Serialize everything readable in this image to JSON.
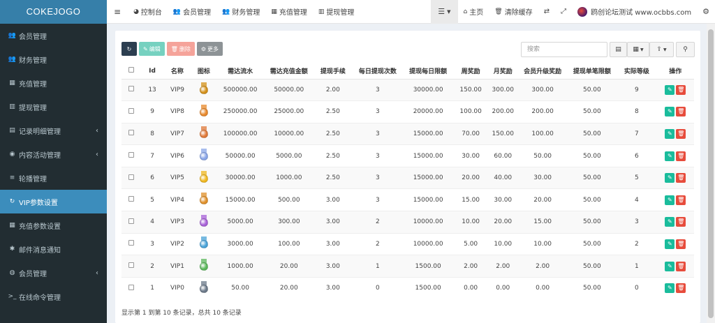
{
  "brand": "COKEJOGO",
  "sidebar": {
    "items": [
      {
        "label": "会员管理",
        "icon": "users-icon",
        "glyph": "👥",
        "arrow": ""
      },
      {
        "label": "财务管理",
        "icon": "users-icon",
        "glyph": "👥",
        "arrow": ""
      },
      {
        "label": "充值管理",
        "icon": "grid-icon",
        "glyph": "▦",
        "arrow": ""
      },
      {
        "label": "提现管理",
        "icon": "bank-icon",
        "glyph": "▥",
        "arrow": ""
      },
      {
        "label": "记录明细管理",
        "icon": "bar-chart-icon",
        "glyph": "▤",
        "arrow": "‹"
      },
      {
        "label": "内容活动管理",
        "icon": "globe-icon",
        "glyph": "◉",
        "arrow": "‹"
      },
      {
        "label": "轮播管理",
        "icon": "list-icon",
        "glyph": "≡",
        "arrow": ""
      },
      {
        "label": "VIP参数设置",
        "icon": "refresh-icon",
        "glyph": "↻",
        "arrow": ""
      },
      {
        "label": "充值参数设置",
        "icon": "grid-icon",
        "glyph": "▦",
        "arrow": ""
      },
      {
        "label": "邮件消息通知",
        "icon": "asterisk-icon",
        "glyph": "✱",
        "arrow": ""
      },
      {
        "label": "会员管理",
        "icon": "user-circle-icon",
        "glyph": "◍",
        "arrow": "‹"
      },
      {
        "label": "在线命令管理",
        "icon": "terminal-icon",
        "glyph": ">_",
        "arrow": ""
      }
    ],
    "active_index": 7
  },
  "topbar": {
    "menu_toggle": "≡",
    "dashboard": "控制台",
    "members": "会员管理",
    "finance": "财务管理",
    "recharge": "充值管理",
    "withdraw": "提现管理",
    "home": "主页",
    "clear_cache": "清除缓存",
    "site_name": "鸥创论坛测试 www.ocbbs.com"
  },
  "toolbar": {
    "edit": "编辑",
    "delete": "删除",
    "more": "更多",
    "search_placeholder": "搜索"
  },
  "table": {
    "headers": [
      "Id",
      "名称",
      "图标",
      "需达流水",
      "需达充值金额",
      "提现手续",
      "每日提现次数",
      "提现每日限额",
      "周奖励",
      "月奖励",
      "会员升级奖励",
      "提现单笔限额",
      "实际等级",
      "操作"
    ],
    "rows": [
      {
        "id": "13",
        "name": "VIP9",
        "medal": "#d4911a",
        "turnover": "500000.00",
        "recharge": "50000.00",
        "fee": "2.00",
        "daily_times": "3",
        "daily_limit": "30000.00",
        "weekly": "150.00",
        "monthly": "300.00",
        "upgrade": "300.00",
        "single_limit": "50.00",
        "level": "9"
      },
      {
        "id": "9",
        "name": "VIP8",
        "medal": "#e8892c",
        "turnover": "250000.00",
        "recharge": "25000.00",
        "fee": "2.50",
        "daily_times": "3",
        "daily_limit": "20000.00",
        "weekly": "100.00",
        "monthly": "200.00",
        "upgrade": "200.00",
        "single_limit": "50.00",
        "level": "8"
      },
      {
        "id": "8",
        "name": "VIP7",
        "medal": "#e07a3a",
        "turnover": "100000.00",
        "recharge": "10000.00",
        "fee": "2.50",
        "daily_times": "3",
        "daily_limit": "15000.00",
        "weekly": "70.00",
        "monthly": "150.00",
        "upgrade": "100.00",
        "single_limit": "50.00",
        "level": "7"
      },
      {
        "id": "7",
        "name": "VIP6",
        "medal": "#8aa6e8",
        "turnover": "50000.00",
        "recharge": "5000.00",
        "fee": "2.50",
        "daily_times": "3",
        "daily_limit": "15000.00",
        "weekly": "30.00",
        "monthly": "60.00",
        "upgrade": "50.00",
        "single_limit": "50.00",
        "level": "6"
      },
      {
        "id": "6",
        "name": "VIP5",
        "medal": "#f0b820",
        "turnover": "30000.00",
        "recharge": "1000.00",
        "fee": "2.50",
        "daily_times": "3",
        "daily_limit": "15000.00",
        "weekly": "20.00",
        "monthly": "40.00",
        "upgrade": "30.00",
        "single_limit": "50.00",
        "level": "5"
      },
      {
        "id": "5",
        "name": "VIP4",
        "medal": "#e0902a",
        "turnover": "15000.00",
        "recharge": "500.00",
        "fee": "3.00",
        "daily_times": "3",
        "daily_limit": "15000.00",
        "weekly": "15.00",
        "monthly": "30.00",
        "upgrade": "20.00",
        "single_limit": "50.00",
        "level": "4"
      },
      {
        "id": "4",
        "name": "VIP3",
        "medal": "#a862d8",
        "turnover": "5000.00",
        "recharge": "300.00",
        "fee": "3.00",
        "daily_times": "2",
        "daily_limit": "10000.00",
        "weekly": "10.00",
        "monthly": "20.00",
        "upgrade": "15.00",
        "single_limit": "50.00",
        "level": "3"
      },
      {
        "id": "3",
        "name": "VIP2",
        "medal": "#4aa3d8",
        "turnover": "3000.00",
        "recharge": "100.00",
        "fee": "3.00",
        "daily_times": "2",
        "daily_limit": "10000.00",
        "weekly": "5.00",
        "monthly": "10.00",
        "upgrade": "10.00",
        "single_limit": "50.00",
        "level": "2"
      },
      {
        "id": "2",
        "name": "VIP1",
        "medal": "#5cb85c",
        "turnover": "1000.00",
        "recharge": "20.00",
        "fee": "3.00",
        "daily_times": "1",
        "daily_limit": "1500.00",
        "weekly": "2.00",
        "monthly": "2.00",
        "upgrade": "2.00",
        "single_limit": "50.00",
        "level": "1"
      },
      {
        "id": "1",
        "name": "VIP0",
        "medal": "#6c7a8a",
        "turnover": "50.00",
        "recharge": "20.00",
        "fee": "3.00",
        "daily_times": "0",
        "daily_limit": "1500.00",
        "weekly": "0.00",
        "monthly": "0.00",
        "upgrade": "0.00",
        "single_limit": "50.00",
        "level": "0"
      }
    ]
  },
  "footer": "显示第 1 到第 10 条记录，总共 10 条记录",
  "colors": {
    "sidebar_bg": "#222d32",
    "logo_bg": "#367fa9",
    "active": "#3c8dbc",
    "edit": "#1abc9c",
    "delete": "#e74c3c"
  }
}
